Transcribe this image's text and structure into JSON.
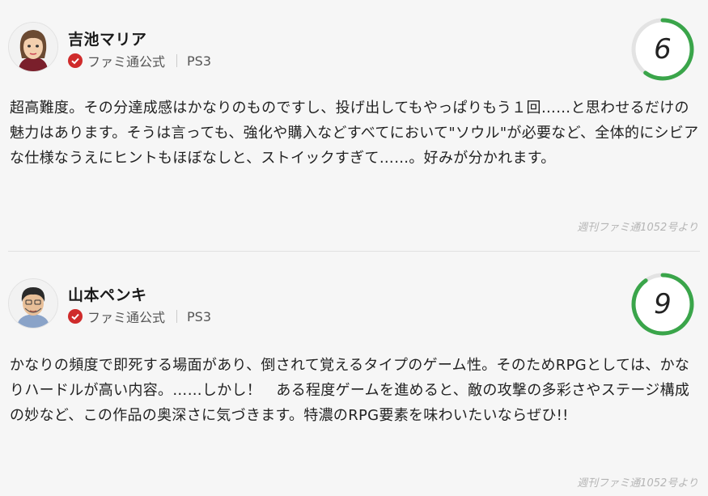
{
  "reviews": [
    {
      "name": "吉池マリア",
      "badge": "ファミ通公式",
      "platform": "PS3",
      "score": "6",
      "score_fraction": 0.6,
      "text": "超高難度。その分達成感はかなりのものですし、投げ出してもやっぱりもう１回……と思わせるだけの魅力はあります。そうは言っても、強化や購入などすべてにおいて\"ソウル\"が必要など、全体的にシビアな仕様なうえにヒントもほぼなしと、ストイックすぎて……。好みが分かれます。",
      "source": "週刊ファミ通1052号より"
    },
    {
      "name": "山本ペンキ",
      "badge": "ファミ通公式",
      "platform": "PS3",
      "score": "9",
      "score_fraction": 0.9,
      "text": "かなりの頻度で即死する場面があり、倒されて覚えるタイプのゲーム性。そのためRPGとしては、かなりハードルが高い内容。……しかし！　ある程度ゲームを進めると、敵の攻撃の多彩さやステージ構成の妙など、この作品の奥深さに気づきます。特濃のRPG要素を味わいたいならぜひ!!",
      "source": "週刊ファミ通1052号より"
    }
  ],
  "colors": {
    "score_ring": "#3aa54a",
    "score_ring_track": "#e3e3e3",
    "badge": "#cf2b2b",
    "background": "#f6f6f6"
  }
}
